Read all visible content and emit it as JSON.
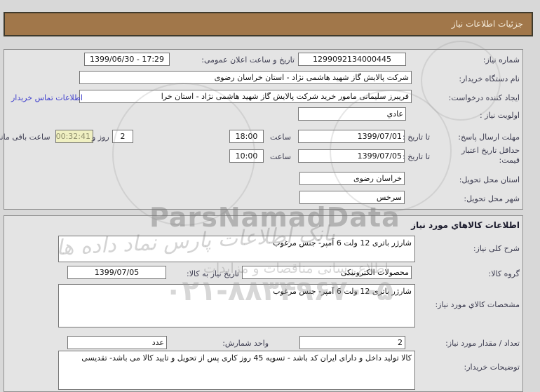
{
  "header": {
    "title": "جزئیات اطلاعات نیاز"
  },
  "need_info": {
    "need_number_label": "شماره نیاز:",
    "need_number_value": "1299092134000445",
    "announce_label": "تاریخ و ساعت اعلان عمومی:",
    "announce_value": "1399/06/30 - 17:29",
    "buyer_org_label": "نام دستگاه خریدار:",
    "buyer_org_value": "شرکت پالایش گاز شهید هاشمی نژاد - استان خراسان رضوی",
    "creator_label": "ایجاد کننده درخواست:",
    "creator_value": "فریبرز  سلیمانی مامور خرید شرکت پالایش گاز شهید هاشمی نژاد - استان خرا",
    "contact_link": "اطلاعات تماس خریدار",
    "priority_label": "اولویت نیاز :",
    "priority_value": "عادي",
    "deadline_label": "مهلت ارسال پاسخ:",
    "deadline_until": "تا تاریخ :",
    "deadline_date": "1399/07/01",
    "hour_label": "ساعت",
    "deadline_time": "18:00",
    "countdown_days": "2",
    "countdown_days_label": "روز و",
    "countdown_time": "00:32:41",
    "countdown_label": "ساعت باقی مانده",
    "validity_label": "حداقل تاریخ اعتبار قیمت:",
    "validity_until": "تا تاریخ :",
    "validity_date": "1399/07/05",
    "validity_hour_label": "ساعت",
    "validity_time": "10:00",
    "province_label": "استان محل تحویل:",
    "province_value": "خراسان رضوی",
    "city_label": "شهر محل تحویل:",
    "city_value": "سرخس"
  },
  "goods": {
    "section_title": "اطلاعات کالاهاي مورد نیاز",
    "desc_label": "شرح کلی نیاز:",
    "desc_value": "شارژر باتری 12 ولت 6 آمپر- جنس مرغوب",
    "group_label": "گروه کالا:",
    "group_value": "محصولات الکترونیکی",
    "need_date_label": "تاریخ نیاز به کالا:",
    "need_date_value": "1399/07/05",
    "spec_label": "مشخصات کالاي مورد نیاز:",
    "spec_value": "شارژر باتری 12 ولت 6 آمپر- جنس مرغوب",
    "qty_label": "تعداد / مقدار مورد نیاز:",
    "qty_value": "2",
    "unit_label": "واحد شمارش:",
    "unit_value": "عدد",
    "notes_label": "توضیحات خریدار:",
    "notes_value": "کالا تولید داخل و دارای ایران کد باشد - تسویه 45 روز کاری پس از تحویل و تایید کالا می باشد- تقدیسی"
  },
  "watermarks": {
    "brand": "ParsNamadData",
    "phone": "۰۲۱-۸۸۳۴۹۶۷۰-۵",
    "script1": "بانک اطلاعات پارس نماد داده ها",
    "script2": "اطلاع رسانی مناقصات و مزایدات"
  },
  "colors": {
    "header_bg": "#a1774a",
    "link": "#4242cd",
    "countdown_bg": "#f0f0c2"
  }
}
